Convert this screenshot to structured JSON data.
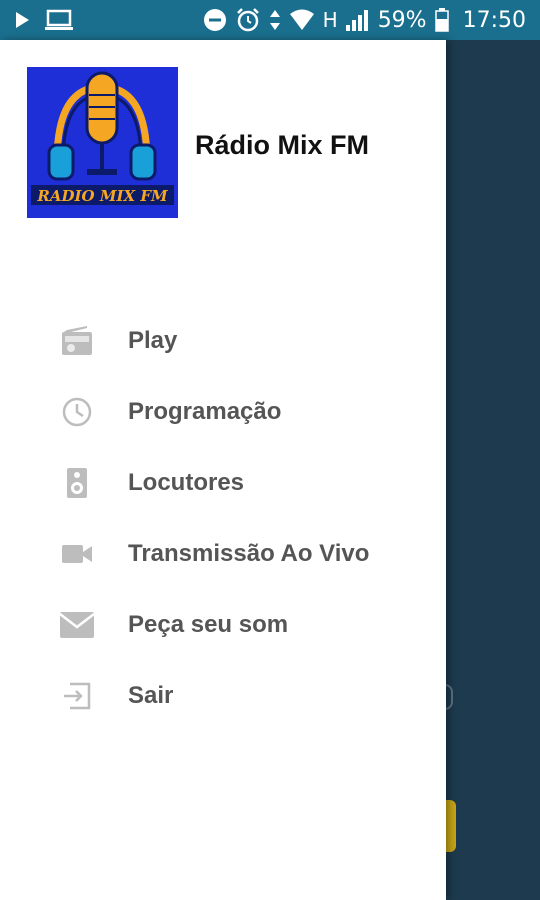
{
  "status_bar": {
    "network_type": "H",
    "battery": "59%",
    "time": "17:50",
    "color": "#1a6f8e"
  },
  "drawer": {
    "app_title": "Rádio Mix FM",
    "logo": {
      "text": "RADIO MIX FM",
      "bg_color": "#1f2fd8",
      "accent_color": "#f5a623"
    },
    "menu": [
      {
        "label": "Play",
        "icon": "radio-icon"
      },
      {
        "label": "Programação",
        "icon": "clock-icon"
      },
      {
        "label": "Locutores",
        "icon": "speaker-icon"
      },
      {
        "label": "Transmissão Ao Vivo",
        "icon": "video-camera-icon"
      },
      {
        "label": "Peça seu som",
        "icon": "envelope-icon"
      },
      {
        "label": "Sair",
        "icon": "exit-icon"
      }
    ]
  }
}
